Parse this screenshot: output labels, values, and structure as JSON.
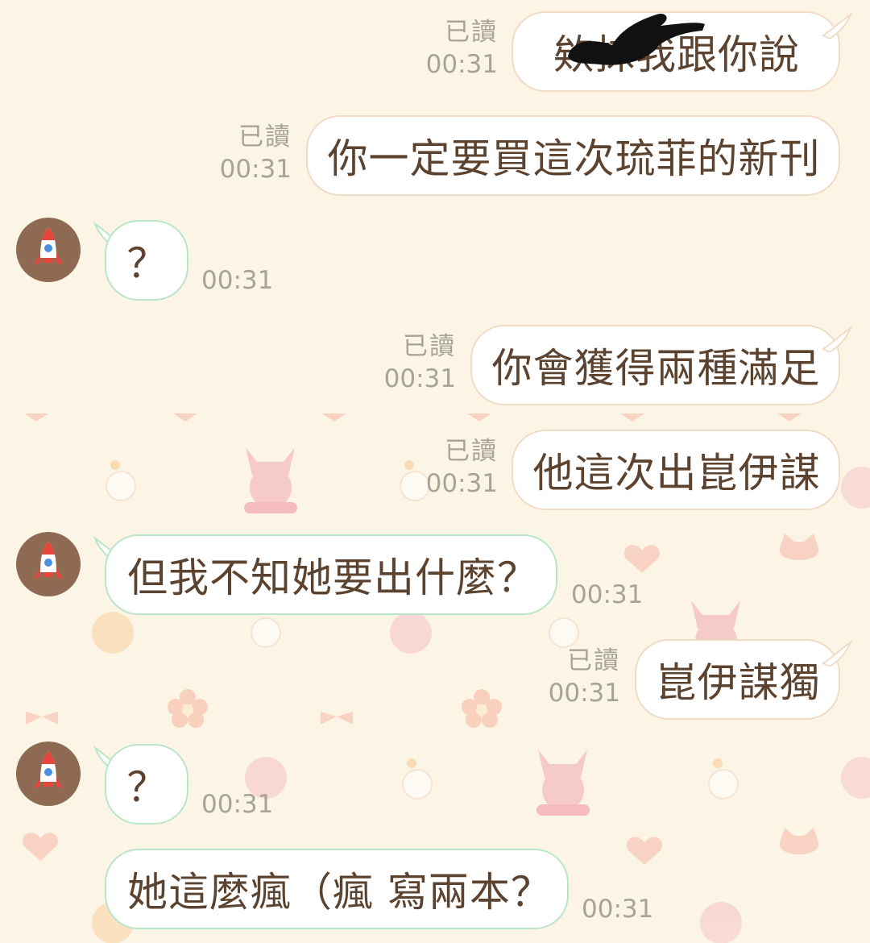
{
  "messages": [
    {
      "dir": "out",
      "text": "欸抹我跟你說",
      "read": "已讀",
      "time": "00:31"
    },
    {
      "dir": "out",
      "text": "你一定要買這次琉菲的新刊",
      "read": "已讀",
      "time": "00:31"
    },
    {
      "dir": "in",
      "text": "？",
      "time": "00:31"
    },
    {
      "dir": "out",
      "text": "你會獲得兩種滿足",
      "read": "已讀",
      "time": "00:31"
    },
    {
      "dir": "out",
      "text": "他這次出崑伊謀",
      "read": "已讀",
      "time": "00:31"
    },
    {
      "dir": "in",
      "text": "但我不知她要出什麼？",
      "time": "00:31"
    },
    {
      "dir": "out",
      "text": "崑伊謀獨",
      "read": "已讀",
      "time": "00:31"
    },
    {
      "dir": "in",
      "text": "？",
      "time": "00:31"
    },
    {
      "dir": "in",
      "text": "她這麼瘋（瘋 寫兩本？",
      "time": "00:31"
    }
  ],
  "colors": {
    "background": "#fcf5e6",
    "outgoing_border": "#f0dcc6",
    "incoming_border": "#b9e6c9",
    "text": "#5c4330",
    "meta": "#a8a29a",
    "avatar": "#8e6a52"
  },
  "icons": {
    "avatar": "rocket-icon",
    "wallpaper": [
      "cat-girl",
      "chick",
      "heart",
      "cat-face",
      "flower",
      "ribbon"
    ]
  }
}
